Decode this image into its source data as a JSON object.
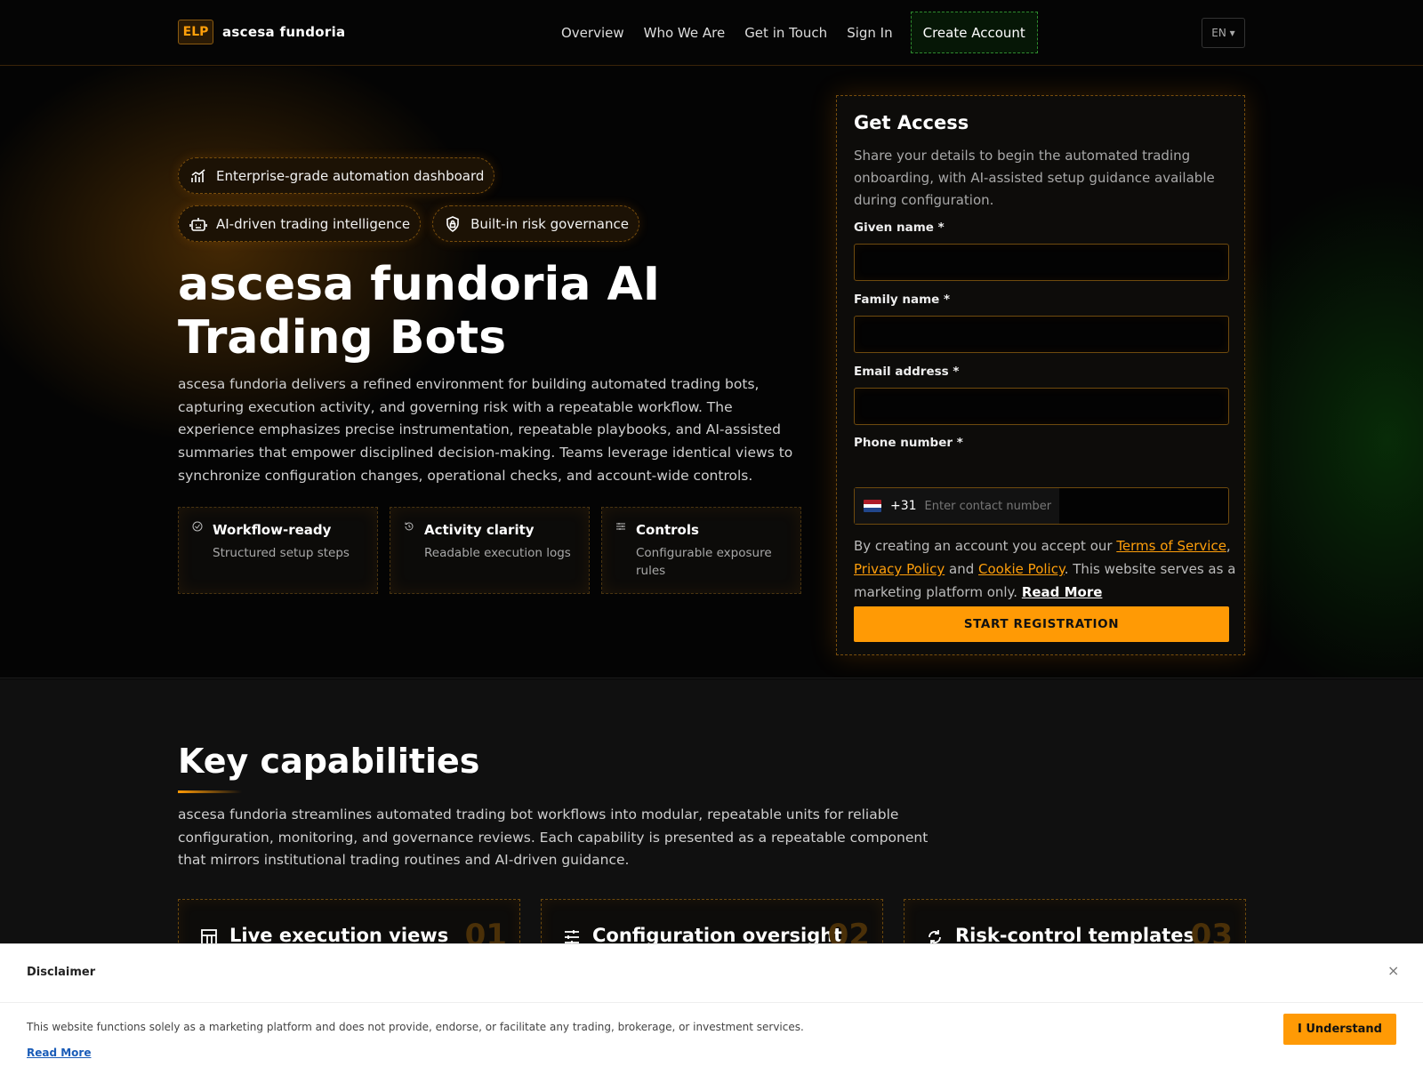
{
  "header": {
    "logo_badge": "ELP",
    "brand": "ascesa fundoria",
    "nav": [
      "Overview",
      "Who We Are",
      "Get in Touch",
      "Sign In"
    ],
    "create_account": "Create Account",
    "language": "EN ▾"
  },
  "hero": {
    "pills": [
      "Enterprise-grade automation dashboard",
      "AI-driven trading intelligence",
      "Built-in risk governance"
    ],
    "title": "ascesa fundoria AI Trading Bots",
    "description": "ascesa fundoria delivers a refined environment for building automated trading bots, capturing execution activity, and governing risk with a repeatable workflow. The experience emphasizes precise instrumentation, repeatable playbooks, and AI-assisted summaries that empower disciplined decision-making. Teams leverage identical views to synchronize configuration changes, operational checks, and account-wide controls.",
    "features": [
      {
        "title": "Workflow-ready",
        "subtitle": "Structured setup steps"
      },
      {
        "title": "Activity clarity",
        "subtitle": "Readable execution logs"
      },
      {
        "title": "Controls",
        "subtitle": "Configurable exposure rules"
      }
    ]
  },
  "form": {
    "title": "Get Access",
    "intro": "Share your details to begin the automated trading onboarding, with AI-assisted setup guidance available during configuration.",
    "given_name_label": "Given name *",
    "family_name_label": "Family name *",
    "email_label": "Email address *",
    "phone_label": "Phone number *",
    "phone_code": "+31",
    "phone_placeholder": "Enter contact number",
    "consent_prefix": "By creating an account you accept our ",
    "terms": "Terms of Service",
    "comma": ", ",
    "privacy": "Privacy Policy",
    "and": " and ",
    "cookie": "Cookie Policy",
    "consent_suffix": ". This website serves as a marketing platform only. ",
    "read_more": "Read More",
    "submit": "START REGISTRATION"
  },
  "capabilities": {
    "title": "Key capabilities",
    "description": "ascesa fundoria streamlines automated trading bot workflows into modular, repeatable units for reliable configuration, monitoring, and governance reviews. Each capability is presented as a repeatable component that mirrors institutional trading routines and AI-driven guidance.",
    "cards": [
      {
        "title": "Live execution views",
        "number": "01",
        "icon": "grid-icon"
      },
      {
        "title": "Configuration oversight",
        "number": "02",
        "icon": "sliders-icon"
      },
      {
        "title": "Risk-control templates",
        "number": "03",
        "icon": "refresh-icon"
      }
    ]
  },
  "disclaimer": {
    "title": "Disclaimer",
    "close": "×",
    "text": "This website functions solely as a marketing platform and does not provide, endorse, or facilitate any trading, brokerage, or investment services.",
    "read_more": "Read More",
    "button": "I Understand"
  },
  "colors": {
    "accent": "#ff9a05",
    "create_button_border": "#2e8a2e",
    "background": "#050505"
  }
}
